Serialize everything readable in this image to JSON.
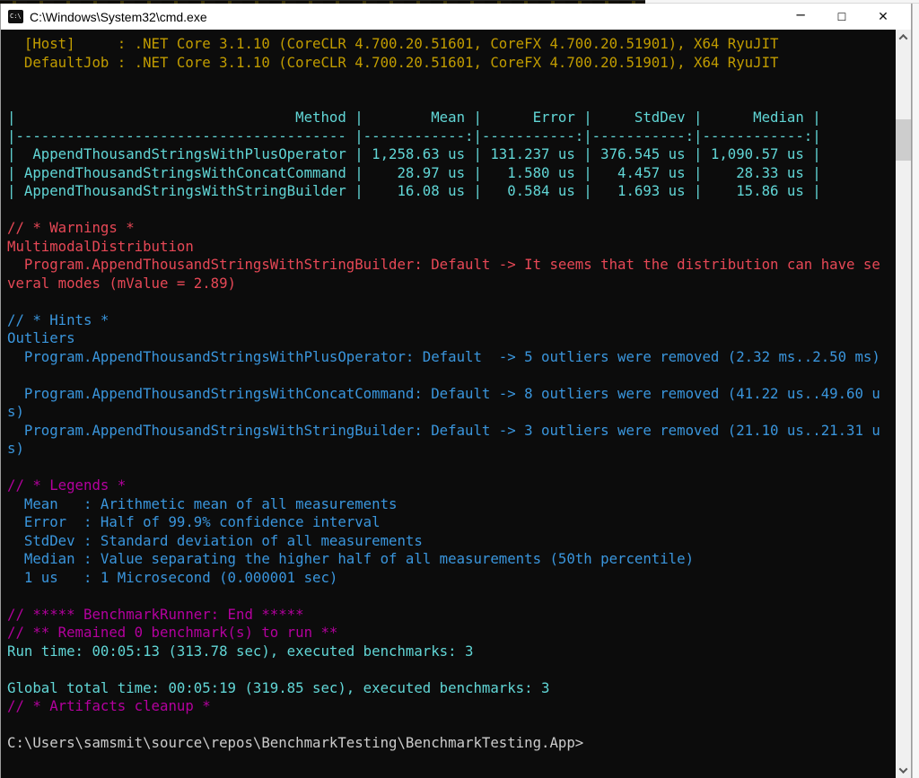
{
  "window": {
    "title": "C:\\Windows\\System32\\cmd.exe",
    "controls": {
      "minimize": "─",
      "maximize": "☐",
      "close": "✕"
    }
  },
  "palette": {
    "background": "#0C0C0C",
    "yellow": "#C19C00",
    "cyan": "#61D6D6",
    "red": "#E74856",
    "blue": "#3A96DD",
    "magenta": "#B4009E",
    "white": "#CCCCCC"
  },
  "benchmark_table": {
    "columns": [
      "Method",
      "Mean",
      "Error",
      "StdDev",
      "Median"
    ],
    "rows": [
      [
        "AppendThousandStringsWithPlusOperator",
        "1,258.63 us",
        "131.237 us",
        "376.545 us",
        "1,090.57 us"
      ],
      [
        "AppendThousandStringsWithConcatCommand",
        "28.97 us",
        "1.580 us",
        "4.457 us",
        "28.33 us"
      ],
      [
        "AppendThousandStringsWithStringBuilder",
        "16.08 us",
        "0.584 us",
        "1.693 us",
        "15.86 us"
      ]
    ]
  },
  "terminal": {
    "lines": [
      {
        "c": "yellow",
        "t": "  [Host]     : .NET Core 3.1.10 (CoreCLR 4.700.20.51601, CoreFX 4.700.20.51901), X64 RyuJIT"
      },
      {
        "c": "yellow",
        "t": "  DefaultJob : .NET Core 3.1.10 (CoreCLR 4.700.20.51601, CoreFX 4.700.20.51901), X64 RyuJIT"
      },
      {
        "c": "white",
        "t": ""
      },
      {
        "c": "white",
        "t": ""
      },
      {
        "c": "cyan",
        "t": "|                                 Method |        Mean |      Error |     StdDev |      Median |"
      },
      {
        "c": "cyan",
        "t": "|--------------------------------------- |------------:|-----------:|-----------:|------------:|"
      },
      {
        "c": "cyan",
        "t": "|  AppendThousandStringsWithPlusOperator | 1,258.63 us | 131.237 us | 376.545 us | 1,090.57 us |"
      },
      {
        "c": "cyan",
        "t": "| AppendThousandStringsWithConcatCommand |    28.97 us |   1.580 us |   4.457 us |    28.33 us |"
      },
      {
        "c": "cyan",
        "t": "| AppendThousandStringsWithStringBuilder |    16.08 us |   0.584 us |   1.693 us |    15.86 us |"
      },
      {
        "c": "white",
        "t": ""
      },
      {
        "c": "red",
        "t": "// * Warnings *"
      },
      {
        "c": "red",
        "t": "MultimodalDistribution"
      },
      {
        "c": "red",
        "t": "  Program.AppendThousandStringsWithStringBuilder: Default -> It seems that the distribution can have se"
      },
      {
        "c": "red",
        "t": "veral modes (mValue = 2.89)"
      },
      {
        "c": "white",
        "t": ""
      },
      {
        "c": "blue",
        "t": "// * Hints *"
      },
      {
        "c": "blue",
        "t": "Outliers"
      },
      {
        "c": "blue",
        "t": "  Program.AppendThousandStringsWithPlusOperator: Default  -> 5 outliers were removed (2.32 ms..2.50 ms)"
      },
      {
        "c": "white",
        "t": ""
      },
      {
        "c": "blue",
        "t": "  Program.AppendThousandStringsWithConcatCommand: Default -> 8 outliers were removed (41.22 us..49.60 u"
      },
      {
        "c": "blue",
        "t": "s)"
      },
      {
        "c": "blue",
        "t": "  Program.AppendThousandStringsWithStringBuilder: Default -> 3 outliers were removed (21.10 us..21.31 u"
      },
      {
        "c": "blue",
        "t": "s)"
      },
      {
        "c": "white",
        "t": ""
      },
      {
        "c": "magenta",
        "t": "// * Legends *"
      },
      {
        "c": "blue",
        "t": "  Mean   : Arithmetic mean of all measurements"
      },
      {
        "c": "blue",
        "t": "  Error  : Half of 99.9% confidence interval"
      },
      {
        "c": "blue",
        "t": "  StdDev : Standard deviation of all measurements"
      },
      {
        "c": "blue",
        "t": "  Median : Value separating the higher half of all measurements (50th percentile)"
      },
      {
        "c": "blue",
        "t": "  1 us   : 1 Microsecond (0.000001 sec)"
      },
      {
        "c": "white",
        "t": ""
      },
      {
        "c": "magenta",
        "t": "// ***** BenchmarkRunner: End *****"
      },
      {
        "c": "magenta",
        "t": "// ** Remained 0 benchmark(s) to run **"
      },
      {
        "c": "cyan",
        "t": "Run time: 00:05:13 (313.78 sec), executed benchmarks: 3"
      },
      {
        "c": "white",
        "t": ""
      },
      {
        "c": "cyan",
        "t": "Global total time: 00:05:19 (319.85 sec), executed benchmarks: 3"
      },
      {
        "c": "magenta",
        "t": "// * Artifacts cleanup *"
      },
      {
        "c": "white",
        "t": ""
      },
      {
        "c": "white",
        "t": "C:\\Users\\samsmit\\source\\repos\\BenchmarkTesting\\BenchmarkTesting.App>"
      }
    ]
  }
}
